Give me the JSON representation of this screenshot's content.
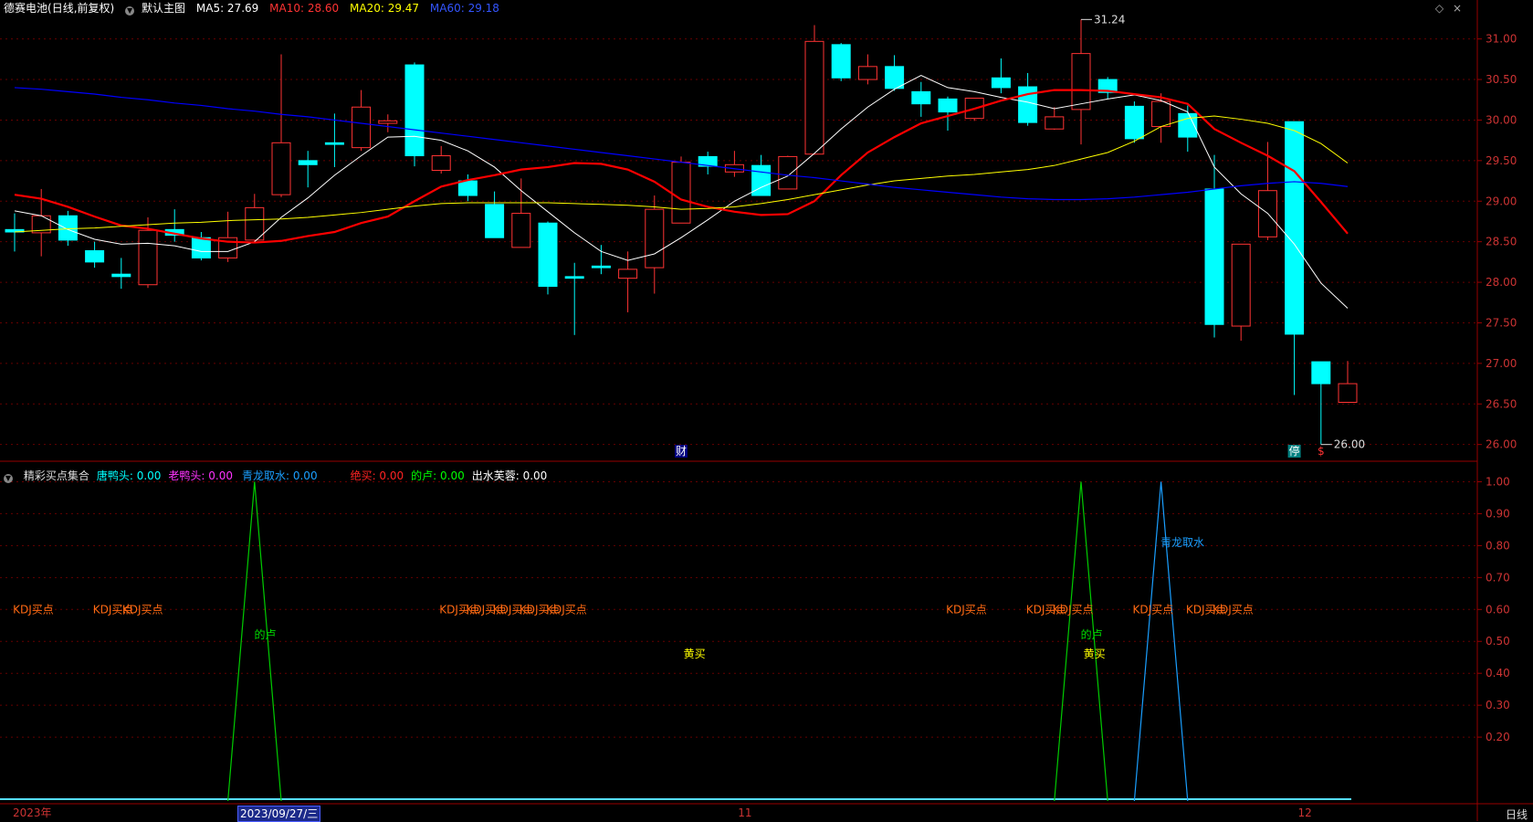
{
  "header": {
    "stock_name": "德赛电池",
    "period": "(日线,前复权)",
    "main_chart_label": "默认主图",
    "ma5": "MA5: 27.69",
    "ma10": "MA10: 28.60",
    "ma20": "MA20: 29.47",
    "ma60": "MA60: 29.18",
    "right_buttons": [
      "◇",
      "×"
    ]
  },
  "colors": {
    "bg": "#000000",
    "up": "#ff3333",
    "down": "#00ffff",
    "ma5": "#ffffff",
    "ma10": "#ff0000",
    "ma20": "#ffff00",
    "ma60": "#0000ff",
    "axis": "#990000",
    "grid": "#660000",
    "dian_lu": "#00cc00",
    "qinglong": "#1a9fff",
    "kdj": "#ff6a13",
    "gongmai": "#ffff00"
  },
  "chart_data": [
    {
      "type": "candlestick",
      "title": "德赛电池 (日线,前复权)",
      "ylim": [
        25.85,
        31.3
      ],
      "y_ticks": [
        "31.00",
        "30.50",
        "30.00",
        "29.50",
        "29.00",
        "28.50",
        "28.00",
        "27.50",
        "27.00",
        "26.50",
        "26.00"
      ],
      "candles": [
        {
          "o": 28.65,
          "c": 28.62,
          "h": 28.85,
          "l": 28.38
        },
        {
          "o": 28.61,
          "c": 28.82,
          "h": 29.15,
          "l": 28.32
        },
        {
          "o": 28.82,
          "c": 28.52,
          "h": 28.88,
          "l": 28.45
        },
        {
          "o": 28.39,
          "c": 28.25,
          "h": 28.5,
          "l": 28.18
        },
        {
          "o": 28.1,
          "c": 28.07,
          "h": 28.3,
          "l": 27.92
        },
        {
          "o": 27.97,
          "c": 28.64,
          "h": 28.8,
          "l": 27.93
        },
        {
          "o": 28.65,
          "c": 28.58,
          "h": 28.9,
          "l": 28.5
        },
        {
          "o": 28.55,
          "c": 28.3,
          "h": 28.62,
          "l": 28.27
        },
        {
          "o": 28.3,
          "c": 28.55,
          "h": 28.87,
          "l": 28.25
        },
        {
          "o": 28.52,
          "c": 28.92,
          "h": 29.09,
          "l": 28.48
        },
        {
          "o": 29.08,
          "c": 29.72,
          "h": 30.81,
          "l": 29.05
        },
        {
          "o": 29.5,
          "c": 29.45,
          "h": 29.62,
          "l": 29.17
        },
        {
          "o": 29.72,
          "c": 29.7,
          "h": 30.08,
          "l": 29.42
        },
        {
          "o": 29.66,
          "c": 30.16,
          "h": 30.37,
          "l": 29.62
        },
        {
          "o": 29.96,
          "c": 29.99,
          "h": 30.07,
          "l": 29.85
        },
        {
          "o": 30.68,
          "c": 29.56,
          "h": 30.71,
          "l": 29.43
        },
        {
          "o": 29.38,
          "c": 29.56,
          "h": 29.68,
          "l": 29.34
        },
        {
          "o": 29.25,
          "c": 29.07,
          "h": 29.33,
          "l": 29.0
        },
        {
          "o": 28.96,
          "c": 28.55,
          "h": 29.12,
          "l": 28.55
        },
        {
          "o": 28.43,
          "c": 28.85,
          "h": 29.28,
          "l": 28.43
        },
        {
          "o": 28.73,
          "c": 27.95,
          "h": 28.75,
          "l": 27.85
        },
        {
          "o": 28.07,
          "c": 28.05,
          "h": 28.24,
          "l": 27.35
        },
        {
          "o": 28.2,
          "c": 28.18,
          "h": 28.46,
          "l": 28.1
        },
        {
          "o": 28.05,
          "c": 28.16,
          "h": 28.38,
          "l": 27.63
        },
        {
          "o": 28.18,
          "c": 28.9,
          "h": 29.07,
          "l": 27.86
        },
        {
          "o": 28.73,
          "c": 29.48,
          "h": 29.55,
          "l": 28.73
        },
        {
          "o": 29.55,
          "c": 29.43,
          "h": 29.61,
          "l": 29.33
        },
        {
          "o": 29.36,
          "c": 29.45,
          "h": 29.62,
          "l": 29.3
        },
        {
          "o": 29.44,
          "c": 29.07,
          "h": 29.57,
          "l": 29.07
        },
        {
          "o": 29.15,
          "c": 29.55,
          "h": 29.56,
          "l": 29.15
        },
        {
          "o": 29.58,
          "c": 30.97,
          "h": 31.17,
          "l": 29.57
        },
        {
          "o": 30.93,
          "c": 30.52,
          "h": 30.95,
          "l": 30.48
        },
        {
          "o": 30.5,
          "c": 30.66,
          "h": 30.81,
          "l": 30.44
        },
        {
          "o": 30.66,
          "c": 30.39,
          "h": 30.8,
          "l": 30.36
        },
        {
          "o": 30.35,
          "c": 30.2,
          "h": 30.47,
          "l": 30.04
        },
        {
          "o": 30.26,
          "c": 30.1,
          "h": 30.29,
          "l": 29.87
        },
        {
          "o": 30.02,
          "c": 30.27,
          "h": 30.27,
          "l": 29.99
        },
        {
          "o": 30.52,
          "c": 30.4,
          "h": 30.76,
          "l": 30.33
        },
        {
          "o": 30.41,
          "c": 29.97,
          "h": 30.58,
          "l": 29.93
        },
        {
          "o": 29.89,
          "c": 30.04,
          "h": 30.16,
          "l": 29.88
        },
        {
          "o": 30.13,
          "c": 30.82,
          "h": 31.24,
          "l": 29.7
        },
        {
          "o": 30.5,
          "c": 30.34,
          "h": 30.53,
          "l": 30.26
        },
        {
          "o": 30.17,
          "c": 29.77,
          "h": 30.23,
          "l": 29.72
        },
        {
          "o": 29.92,
          "c": 30.23,
          "h": 30.33,
          "l": 29.72
        },
        {
          "o": 30.08,
          "c": 29.79,
          "h": 30.18,
          "l": 29.61
        },
        {
          "o": 29.15,
          "c": 27.48,
          "h": 29.57,
          "l": 27.32
        },
        {
          "o": 27.46,
          "c": 28.47,
          "h": 28.47,
          "l": 27.28
        },
        {
          "o": 28.56,
          "c": 29.13,
          "h": 29.73,
          "l": 28.52
        },
        {
          "o": 29.98,
          "c": 27.36,
          "h": 29.98,
          "l": 26.61
        },
        {
          "o": 27.02,
          "c": 26.75,
          "h": 27.02,
          "l": 26.0
        },
        {
          "o": 26.52,
          "c": 26.75,
          "h": 27.03,
          "l": 26.52
        }
      ],
      "series": [
        {
          "name": "MA5",
          "values": [
            28.88,
            28.82,
            28.65,
            28.53,
            28.47,
            28.48,
            28.45,
            28.38,
            28.38,
            28.5,
            28.8,
            29.04,
            29.32,
            29.56,
            29.79,
            29.8,
            29.75,
            29.62,
            29.42,
            29.13,
            28.87,
            28.61,
            28.38,
            28.27,
            28.35,
            28.55,
            28.77,
            29.0,
            29.17,
            29.31,
            29.59,
            29.89,
            30.16,
            30.38,
            30.55,
            30.4,
            30.35,
            30.28,
            30.22,
            30.14,
            30.2,
            30.26,
            30.31,
            30.24,
            30.1,
            29.42,
            29.09,
            28.85,
            28.47,
            27.99,
            27.68
          ]
        },
        {
          "name": "MA10",
          "values": [
            29.08,
            29.03,
            28.93,
            28.81,
            28.7,
            28.66,
            28.6,
            28.54,
            28.5,
            28.49,
            28.51,
            28.57,
            28.62,
            28.73,
            28.81,
            29.0,
            29.18,
            29.26,
            29.32,
            29.39,
            29.42,
            29.47,
            29.46,
            29.39,
            29.24,
            29.02,
            28.93,
            28.87,
            28.83,
            28.84,
            29.0,
            29.32,
            29.6,
            29.79,
            29.96,
            30.05,
            30.14,
            30.24,
            30.32,
            30.37,
            30.37,
            30.36,
            30.32,
            30.28,
            30.2,
            29.89,
            29.72,
            29.56,
            29.37,
            28.99,
            28.6
          ]
        },
        {
          "name": "MA20",
          "values": [
            28.62,
            28.64,
            28.66,
            28.67,
            28.69,
            28.71,
            28.73,
            28.74,
            28.76,
            28.77,
            28.78,
            28.8,
            28.83,
            28.86,
            28.9,
            28.94,
            28.97,
            28.98,
            28.98,
            28.98,
            28.98,
            28.97,
            28.96,
            28.95,
            28.93,
            28.9,
            28.91,
            28.93,
            28.97,
            29.02,
            29.08,
            29.14,
            29.2,
            29.25,
            29.28,
            29.31,
            29.33,
            29.36,
            29.39,
            29.44,
            29.52,
            29.6,
            29.74,
            29.92,
            30.02,
            30.05,
            30.01,
            29.96,
            29.87,
            29.71,
            29.47
          ]
        },
        {
          "name": "MA60",
          "values": [
            30.4,
            30.38,
            30.35,
            30.32,
            30.28,
            30.25,
            30.21,
            30.18,
            30.14,
            30.11,
            30.07,
            30.04,
            30.0,
            29.96,
            29.92,
            29.88,
            29.84,
            29.8,
            29.76,
            29.72,
            29.68,
            29.64,
            29.6,
            29.56,
            29.52,
            29.48,
            29.44,
            29.4,
            29.36,
            29.32,
            29.29,
            29.25,
            29.21,
            29.17,
            29.14,
            29.11,
            29.08,
            29.05,
            29.03,
            29.02,
            29.02,
            29.03,
            29.05,
            29.08,
            29.11,
            29.15,
            29.19,
            29.22,
            29.24,
            29.22,
            29.18
          ]
        }
      ],
      "annotations": [
        {
          "text": "31.24",
          "at": 40,
          "value": 31.24
        },
        {
          "text": "26.00",
          "at": 49,
          "value": 26.0
        }
      ],
      "event_markers": [
        {
          "text": "财",
          "at": 25,
          "color": "#ffffff",
          "bg": "#000080"
        },
        {
          "text": "停",
          "at": 48,
          "color": "#ffffff",
          "bg": "#008080"
        },
        {
          "text": "$",
          "at": 49,
          "color": "#ff3333",
          "bg": ""
        }
      ]
    },
    {
      "type": "line",
      "title": "精彩买点集合",
      "ylim": [
        0,
        1.05
      ],
      "y_ticks": [
        "1.00",
        "0.90",
        "0.80",
        "0.70",
        "0.60",
        "0.50",
        "0.40",
        "0.30",
        "0.20"
      ],
      "legend": [
        {
          "text": "精彩买点集合",
          "color": "#dddddd"
        },
        {
          "text": "唐鸭头: 0.00",
          "color": "#00ffff"
        },
        {
          "text": "老鸭头: 0.00",
          "color": "#ff33ff"
        },
        {
          "text": "青龙取水: 0.00",
          "color": "#1a9fff"
        },
        {
          "text": "绝买: 0.00",
          "color": "#ff2222"
        },
        {
          "text": "的卢: 0.00",
          "color": "#00ff00"
        },
        {
          "text": "出水芙蓉: 0.00",
          "color": "#ffffff"
        }
      ],
      "series": [
        {
          "name": "的卢",
          "color": "#00cc00",
          "spikes": [
            9,
            40
          ]
        },
        {
          "name": "青龙取水",
          "color": "#1a9fff",
          "spikes": [
            43
          ]
        }
      ],
      "labels": [
        {
          "text": "KDJ买点",
          "at": 0.7,
          "value": 0.6,
          "color": "#ff6a13"
        },
        {
          "text": "KDJ买点",
          "at": 3.7,
          "value": 0.6,
          "color": "#ff6a13"
        },
        {
          "text": "KDJ买点",
          "at": 4.8,
          "value": 0.6,
          "color": "#ff6a13"
        },
        {
          "text": "KDJ买点",
          "at": 16.7,
          "value": 0.6,
          "color": "#ff6a13"
        },
        {
          "text": "KDJ买点",
          "at": 17.7,
          "value": 0.6,
          "color": "#ff6a13"
        },
        {
          "text": "KDJ买点",
          "at": 18.7,
          "value": 0.6,
          "color": "#ff6a13"
        },
        {
          "text": "KDJ买点",
          "at": 19.7,
          "value": 0.6,
          "color": "#ff6a13"
        },
        {
          "text": "KDJ买点",
          "at": 20.7,
          "value": 0.6,
          "color": "#ff6a13"
        },
        {
          "text": "KDJ买点",
          "at": 35.7,
          "value": 0.6,
          "color": "#ff6a13"
        },
        {
          "text": "KDJ买点",
          "at": 38.7,
          "value": 0.6,
          "color": "#ff6a13"
        },
        {
          "text": "KDJ买点",
          "at": 39.7,
          "value": 0.6,
          "color": "#ff6a13"
        },
        {
          "text": "KDJ买点",
          "at": 42.7,
          "value": 0.6,
          "color": "#ff6a13"
        },
        {
          "text": "KDJ买点",
          "at": 44.7,
          "value": 0.6,
          "color": "#ff6a13"
        },
        {
          "text": "KDJ买点",
          "at": 45.7,
          "value": 0.6,
          "color": "#ff6a13"
        },
        {
          "text": "的卢",
          "at": 9.4,
          "value": 0.52,
          "color": "#00dd00"
        },
        {
          "text": "的卢",
          "at": 40.4,
          "value": 0.52,
          "color": "#00dd00"
        },
        {
          "text": "黄买",
          "at": 25.5,
          "value": 0.46,
          "color": "#ffff00"
        },
        {
          "text": "黄买",
          "at": 40.5,
          "value": 0.46,
          "color": "#ffff00"
        },
        {
          "text": "青龙取水",
          "at": 43.8,
          "value": 0.81,
          "color": "#1a9fff"
        }
      ]
    }
  ],
  "footer": {
    "x_labels": [
      {
        "text": "2023年",
        "at": 0.0
      },
      {
        "text": "11",
        "at": 27.2
      },
      {
        "text": "12",
        "at": 48.2
      }
    ],
    "selected_date": "2023/09/27/三",
    "period_label": "日线"
  }
}
